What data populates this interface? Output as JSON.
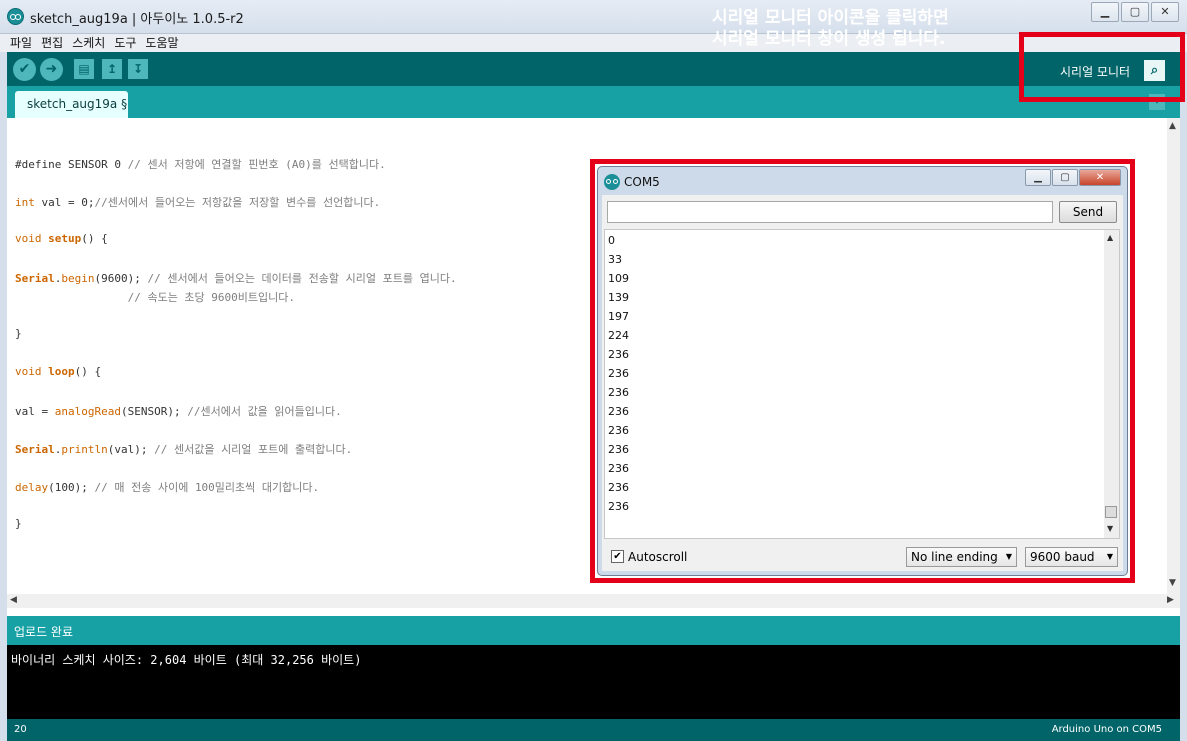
{
  "window": {
    "title": "sketch_aug19a | 아두이노 1.0.5-r2",
    "buttons": {
      "minimize": "▁",
      "maximize": "▢",
      "close": "✕"
    }
  },
  "menu": [
    "파일",
    "편집",
    "스케치",
    "도구",
    "도움말"
  ],
  "toolbar": {
    "verify_icon": "✔",
    "upload_icon": "➜",
    "new_icon": "▤",
    "open_icon": "↥",
    "save_icon": "↧",
    "serial_monitor_label": "시리얼 모니터",
    "serial_monitor_icon": "⌕"
  },
  "annotation": {
    "line1": "시리얼 모니터 아이콘을 클릭하면",
    "line2": "시리얼 모니터 창이 생성 됩니다."
  },
  "tab": {
    "label": "sketch_aug19a §",
    "menu_icon": "▾"
  },
  "code": [
    {
      "parts": [
        [
          "#define SENSOR 0 ",
          ""
        ],
        [
          "// 센서 저항에 연결할 핀번호 (A0)를 선택합니다.",
          "cmt"
        ]
      ]
    },
    {
      "parts": [
        [
          "int",
          "kw"
        ],
        [
          " val = 0;",
          ""
        ],
        [
          "//센서에서 들어오는 저항값을 저장할 변수를 선언합니다.",
          "cmt"
        ]
      ]
    },
    {
      "parts": [
        [
          "void",
          "kw"
        ],
        [
          " ",
          ""
        ],
        [
          "setup",
          "kw2"
        ],
        [
          "() {",
          ""
        ]
      ]
    },
    {
      "parts": [
        [
          "Serial",
          "kw2"
        ],
        [
          ".",
          ""
        ],
        [
          "begin",
          "typ"
        ],
        [
          "(9600); ",
          ""
        ],
        [
          "// 센서에서 들어오는 데이터를 전송할 시리얼 포트를 엽니다.",
          "cmt"
        ]
      ]
    },
    {
      "parts": [
        [
          "                 // 속도는 초당 9600비트입니다.",
          "cmt"
        ]
      ]
    },
    {
      "parts": [
        [
          "}",
          ""
        ]
      ]
    },
    {
      "parts": [
        [
          "void",
          "kw"
        ],
        [
          " ",
          ""
        ],
        [
          "loop",
          "kw2"
        ],
        [
          "() {",
          ""
        ]
      ]
    },
    {
      "parts": [
        [
          "val = ",
          ""
        ],
        [
          "analogRead",
          "typ"
        ],
        [
          "(SENSOR); ",
          ""
        ],
        [
          "//센서에서 값을 읽어들입니다.",
          "cmt"
        ]
      ]
    },
    {
      "parts": [
        [
          "Serial",
          "kw2"
        ],
        [
          ".",
          ""
        ],
        [
          "println",
          "typ"
        ],
        [
          "(val); ",
          ""
        ],
        [
          "// 센서값을 시리얼 포트에 출력합니다.",
          "cmt"
        ]
      ]
    },
    {
      "parts": [
        [
          "delay",
          "typ"
        ],
        [
          "(100); ",
          ""
        ],
        [
          "// 매 전송 사이에 100밀리초씩 대기합니다.",
          "cmt"
        ]
      ]
    },
    {
      "parts": [
        [
          "}",
          ""
        ]
      ]
    }
  ],
  "status": {
    "message": "업로드 완료",
    "console": "바이너리 스케치 사이즈: 2,604 바이트 (최대 32,256 바이트)",
    "line_number": "20",
    "board": "Arduino Uno on COM5"
  },
  "serial_monitor": {
    "title": "COM5",
    "input_value": "",
    "send_label": "Send",
    "output": [
      "0",
      "33",
      "109",
      "139",
      "197",
      "224",
      "236",
      "236",
      "236",
      "236",
      "236",
      "236",
      "236",
      "236",
      "236"
    ],
    "autoscroll_label": "Autoscroll",
    "autoscroll_checked": "✔",
    "line_ending": "No line ending",
    "baud": "9600 baud"
  },
  "colors": {
    "toolbar": "#006468",
    "tab_row": "#17a1a5",
    "highlight": "#e5001a"
  }
}
